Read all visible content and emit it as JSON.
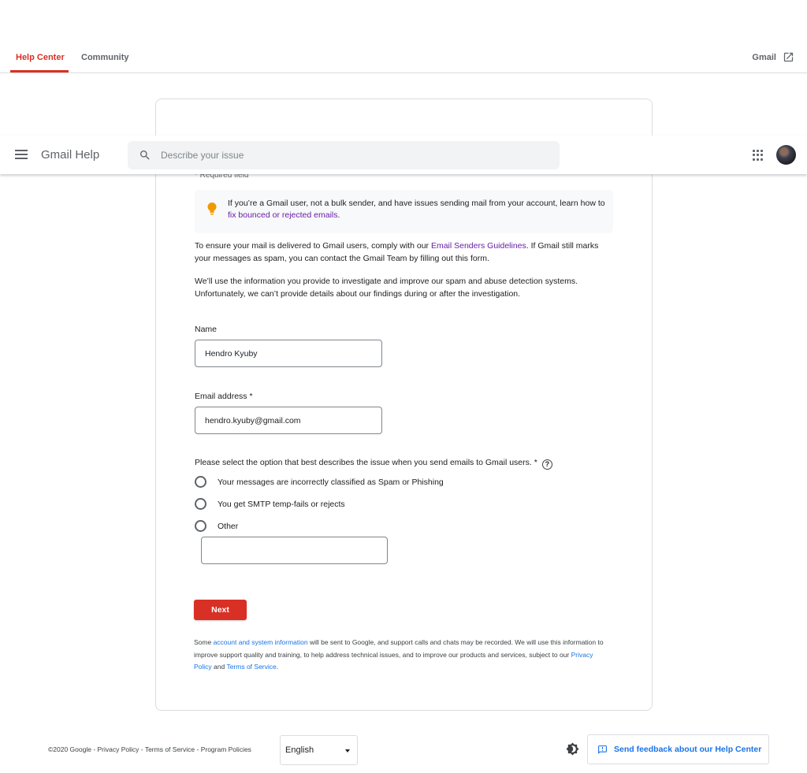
{
  "topnav": {
    "tabs": [
      "Help Center",
      "Community"
    ],
    "gmail_link": "Gmail"
  },
  "header": {
    "title": "Gmail Help",
    "search_placeholder": "Describe your issue"
  },
  "form": {
    "required_note": "* Required field",
    "tip": {
      "text": "If you’re a Gmail user, not a bulk sender, and have issues sending mail from your account, learn how to ",
      "link": "fix bounced or rejected emails",
      "suffix": "."
    },
    "intro": {
      "before": "To ensure your mail is delivered to Gmail users, comply with our ",
      "link": "Email Senders Guidelines",
      "after": ". If Gmail still marks your messages as spam, you can contact the Gmail Team by filling out this form."
    },
    "investigation_note": "We’ll use the information you provide to investigate and improve our spam and abuse detection systems. Unfortunately, we can’t provide details about our findings during or after the investigation.",
    "name_label": "Name",
    "name_value": "Hendro Kyuby",
    "email_label": "Email address *",
    "email_value": "hendro.kyuby@gmail.com",
    "issue_question": "Please select the option that best describes the issue when you send emails to Gmail users. *",
    "options": [
      "Your messages are incorrectly classified as Spam or Phishing",
      "You get SMTP temp-fails or rejects",
      "Other"
    ],
    "other_value": "",
    "next_label": "Next",
    "disclaimer": {
      "p1": "Some ",
      "link1": "account and system information",
      "p2": " will be sent to Google, and support calls and chats may be recorded. We will use this information to improve support quality and training, to help address technical issues, and to improve our products and services, subject to our ",
      "link2": "Privacy Policy",
      "p3": " and ",
      "link3": "Terms of Service",
      "p4": "."
    }
  },
  "footer": {
    "copyright": "©2020 Google",
    "links": [
      "Privacy Policy",
      "Terms of Service",
      "Program Policies"
    ],
    "separator": " - ",
    "language": "English",
    "feedback": "Send feedback about our Help Center"
  },
  "colors": {
    "accent_red": "#d93025",
    "link_blue": "#1a73e8",
    "link_purple": "#681da8",
    "bulb_orange": "#f29900"
  }
}
